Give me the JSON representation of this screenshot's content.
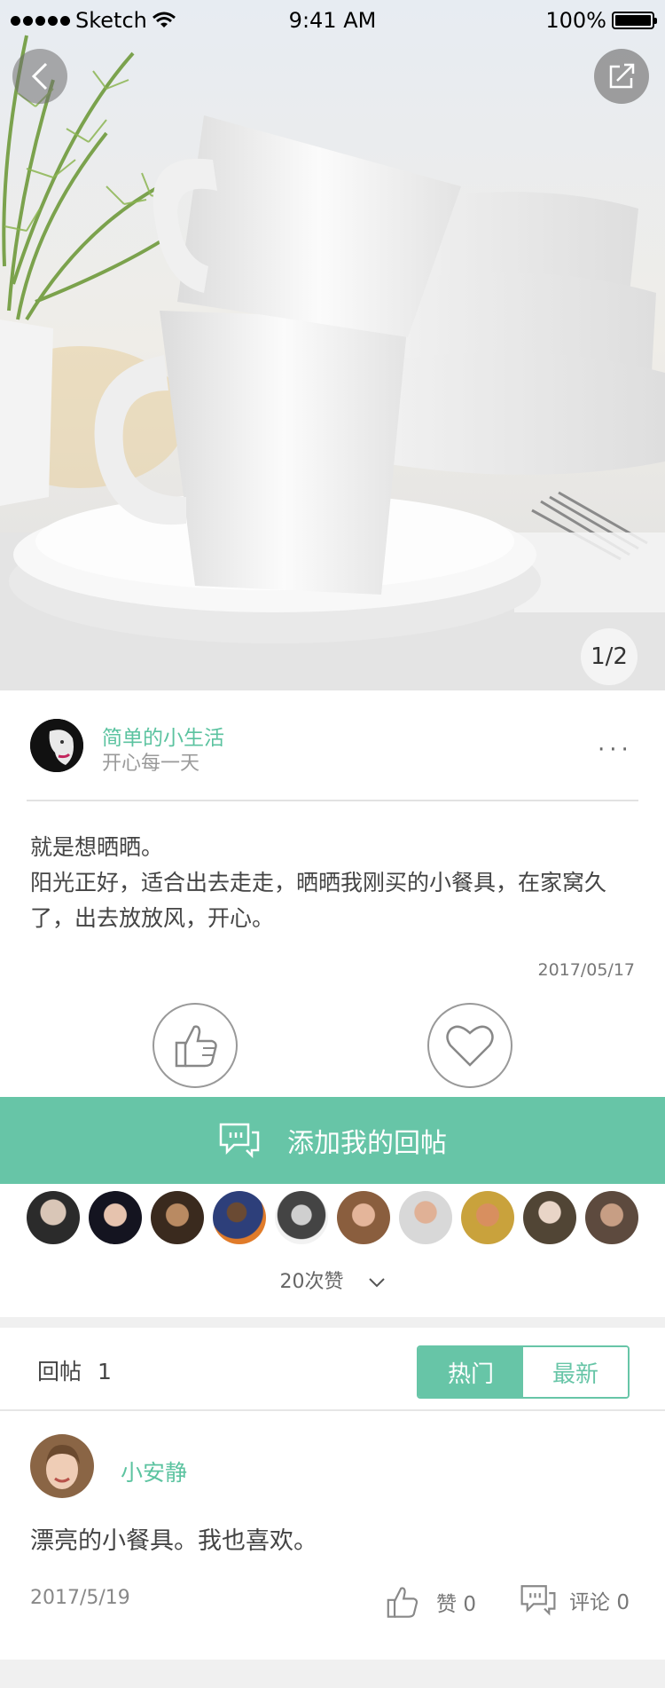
{
  "status_bar": {
    "carrier": "Sketch",
    "time": "9:41 AM",
    "battery": "100%"
  },
  "hero": {
    "page_indicator": "1/2"
  },
  "post": {
    "author_name": "简单的小生活",
    "author_signature": "开心每一天",
    "more": "···",
    "text": "就是想晒晒。\n阳光正好，适合出去走走，晒晒我刚买的小餐具，在家窝久了，出去放放风，开心。",
    "date": "2017/05/17"
  },
  "reply_bar": {
    "label": "添加我的回帖"
  },
  "likers": {
    "count_text": "20次赞",
    "avatar_count": 10
  },
  "replies": {
    "label": "回帖",
    "count": "1",
    "tabs": [
      {
        "label": "热门"
      },
      {
        "label": "最新"
      }
    ],
    "items": [
      {
        "name": "小安静",
        "text": "漂亮的小餐具。我也喜欢。",
        "date": "2017/5/19",
        "like_label": "赞",
        "like_count": "0",
        "comment_label": "评论",
        "comment_count": "0"
      }
    ]
  },
  "colors": {
    "accent": "#67c5a7",
    "accent_text": "#5cc3a0",
    "page_bg": "#f0f0f0"
  },
  "icons": [
    "back-icon",
    "share-icon",
    "thumb-up-icon",
    "heart-icon",
    "chat-icon",
    "chevron-down-icon",
    "wifi-icon",
    "battery-icon"
  ]
}
